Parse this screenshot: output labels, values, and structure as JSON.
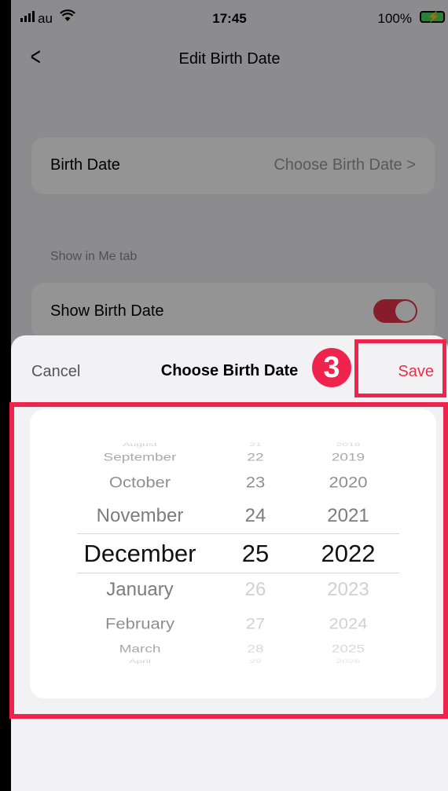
{
  "status_bar": {
    "carrier": "au",
    "wifi_icon": "wifi-icon",
    "time": "17:45",
    "battery_percent": "100%",
    "battery_icon": "battery-charging-icon",
    "battery_glyph": "⚡"
  },
  "nav": {
    "back_icon": "chevron-left-icon",
    "back_glyph": "<",
    "title": "Edit Birth Date"
  },
  "birth_date_row": {
    "label": "Birth Date",
    "value": "Choose Birth Date >"
  },
  "section": {
    "label": "Show in Me tab"
  },
  "show_row": {
    "label": "Show Birth Date",
    "toggle_on": true,
    "toggle_color": "#e8324a"
  },
  "sheet": {
    "cancel": "Cancel",
    "title": "Choose Birth Date",
    "save": "Save"
  },
  "picker": {
    "months": [
      "August",
      "September",
      "October",
      "November",
      "December",
      "January",
      "February",
      "March",
      "April"
    ],
    "days": [
      "21",
      "22",
      "23",
      "24",
      "25",
      "26",
      "27",
      "28",
      "29"
    ],
    "years": [
      "2018",
      "2019",
      "2020",
      "2021",
      "2022",
      "2023",
      "2024",
      "2025",
      "2026"
    ],
    "selected": {
      "month": "December",
      "day": "25",
      "year": "2022"
    }
  },
  "annotation": {
    "step_number": "3",
    "highlight_color": "#f0234c"
  }
}
